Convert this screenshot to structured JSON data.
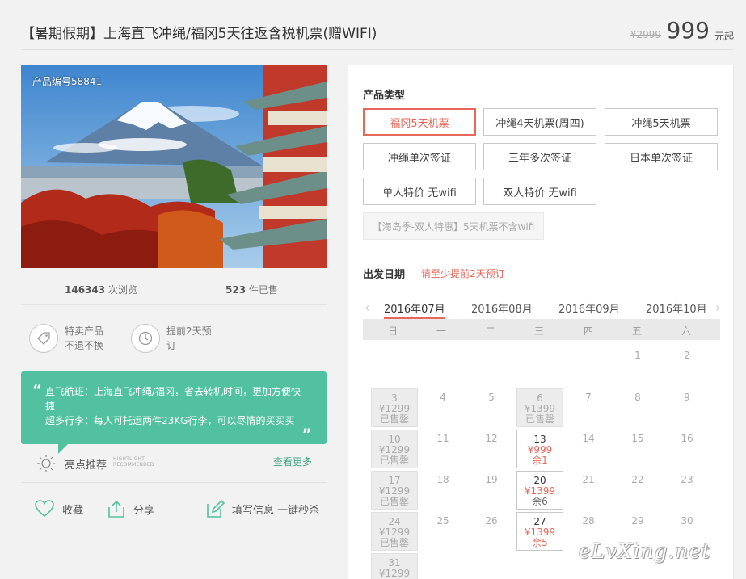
{
  "header": {
    "title": "【暑期假期】上海直飞冲绳/福冈5天往返含税机票(赠WIFI)",
    "old_price": "¥2999",
    "price": "999",
    "price_unit": "元起"
  },
  "photo": {
    "code": "产品编号58841"
  },
  "stats": {
    "views_num": "146343",
    "views_label": " 次浏览",
    "sold_num": "523",
    "sold_label": " 件已售"
  },
  "features": [
    {
      "line1": "特卖产品",
      "line2": "不退不换",
      "icon": "tag-icon"
    },
    {
      "line1": "提前2天预",
      "line2": "订",
      "icon": "clock-icon"
    }
  ],
  "quote": {
    "open": "“",
    "close": "„",
    "line1": "直飞航班：上海直飞冲绳/福冈，省去转机时间，更加方便快捷",
    "line2": "超多行李：每人可托运两件23KG行李，可以尽情的买买买"
  },
  "highlight": {
    "title": "亮点推荐",
    "en1": "HIGHTLIGHT",
    "en2": "RECOMMENDED",
    "more": "查看更多"
  },
  "actions": {
    "favorite": "收藏",
    "share": "分享",
    "fill_info": "填写信息 一键秒杀"
  },
  "product_type": {
    "label": "产品类型",
    "options": [
      {
        "label": "福冈5天机票",
        "selected": true
      },
      {
        "label": "冲绳4天机票(周四)",
        "selected": false
      },
      {
        "label": "冲绳5天机票",
        "selected": false
      },
      {
        "label": "冲绳单次签证",
        "selected": false
      },
      {
        "label": "三年多次签证",
        "selected": false
      },
      {
        "label": "日本单次签证",
        "selected": false
      },
      {
        "label": "单人特价 无wifi",
        "selected": false
      },
      {
        "label": "双人特价 无wifi",
        "selected": false
      }
    ],
    "disabled_option": "【海岛季-双人特惠】5天机票不含wifi"
  },
  "departure": {
    "label": "出发日期",
    "note": "请至少提前2天预订",
    "prev_arrow": "‹",
    "next_arrow": "›",
    "months": [
      "2016年07月",
      "2016年08月",
      "2016年09月",
      "2016年10月"
    ],
    "weekdays": [
      "日",
      "一",
      "二",
      "三",
      "四",
      "五",
      "六"
    ]
  },
  "calendar": {
    "d1": "1",
    "d2": "2",
    "d3": "3",
    "d3p": "¥1299",
    "d3s": "已售罄",
    "d4": "4",
    "d5": "5",
    "d6": "6",
    "d6p": "¥1399",
    "d6s": "已售罄",
    "d7": "7",
    "d8": "8",
    "d9": "9",
    "d10": "10",
    "d10p": "¥1299",
    "d10s": "已售罄",
    "d11": "11",
    "d12": "12",
    "d13": "13",
    "d13p": "¥999",
    "d13s": "余1",
    "d14": "14",
    "d15": "15",
    "d16": "16",
    "d17": "17",
    "d17p": "¥1299",
    "d17s": "已售罄",
    "d18": "18",
    "d19": "19",
    "d20": "20",
    "d20p": "¥1399",
    "d20s": "余6",
    "d21": "21",
    "d22": "22",
    "d23": "23",
    "d24": "24",
    "d24p": "¥1299",
    "d24s": "已售罄",
    "d25": "25",
    "d26": "26",
    "d27": "27",
    "d27p": "¥1399",
    "d27s": "余5",
    "d28": "28",
    "d29": "29",
    "d30": "30",
    "d31": "31",
    "d31p": "¥1299"
  },
  "watermark": "eLvXing.net",
  "colors": {
    "accent": "#e7675a",
    "green": "#52c1a0",
    "link_green": "#3ea283"
  }
}
